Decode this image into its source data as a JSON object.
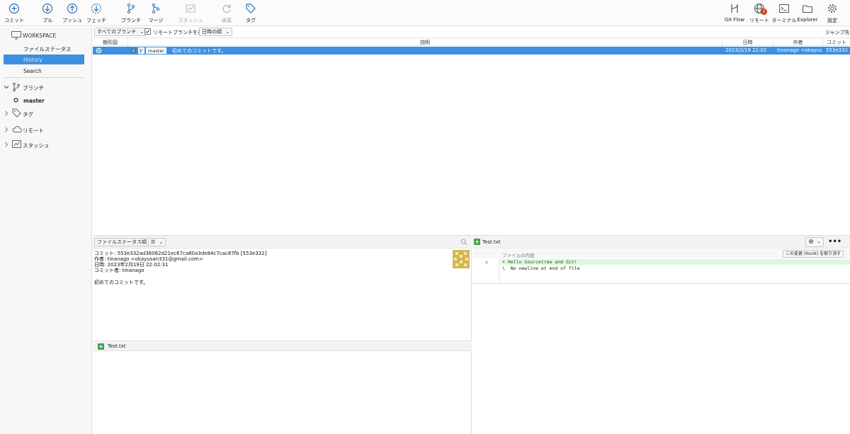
{
  "toolbar": {
    "commit": "コミット",
    "pull": "プル",
    "push": "プッシュ",
    "fetch": "フェッチ",
    "branch": "ブランチ",
    "merge": "マージ",
    "stash": "スタッシュ",
    "discard": "破棄",
    "tag": "タグ",
    "git_flow": "Git Flow",
    "remote": "リモート",
    "terminal": "ターミナル",
    "explorer": "Explorer",
    "settings": "設定",
    "remote_badge": "!"
  },
  "sidebar": {
    "workspace": "WORKSPACE",
    "file_status": "ファイルステータス",
    "history": "History",
    "search": "Search",
    "branches": "ブランチ",
    "branch_master": "master",
    "tags": "タグ",
    "remotes": "リモート",
    "stashes": "スタッシュ"
  },
  "filters": {
    "all_branches": "すべてのブランチ",
    "show_remote": "リモートブランチを表示",
    "order": "日時の順",
    "jump": "ジャンプ先:"
  },
  "columns": {
    "graph": "樹形図",
    "description": "説明",
    "date": "日時",
    "author": "作者",
    "commit": "コミット"
  },
  "commits": [
    {
      "branch": "master",
      "message": "初めてのコミットです。",
      "date": "2023/2/19 22:02",
      "author": "tinanago <okayus",
      "hash": "553e332"
    }
  ],
  "details": {
    "sort": "ファイルステータス順",
    "commit_line": "コミット: 553e332ad36062d21ec67ca80a3de84c7cac87fb [553e332]",
    "author_line": "作者: tinanago <okayusan331@gmail.com>",
    "date_line": "日時: 2023年2月19日 22:02:31",
    "committer_line": "コミット者: tinanago",
    "message": "初めてのコミットです。",
    "file": "Test.txt"
  },
  "diff": {
    "file": "Test.txt",
    "hunk_label": "ファイルの内容",
    "hunk_button": "この変更 (Hunk) を取り消す",
    "line_number": "0",
    "line1": "+ Hello Sourcetree and Git!",
    "line2": "\\  No newline at end of file"
  },
  "colors": {
    "accent": "#3d8fe0",
    "added_line": "#dcf8dc",
    "badge": "#d83b1e",
    "avatar": "#d6b64d"
  }
}
